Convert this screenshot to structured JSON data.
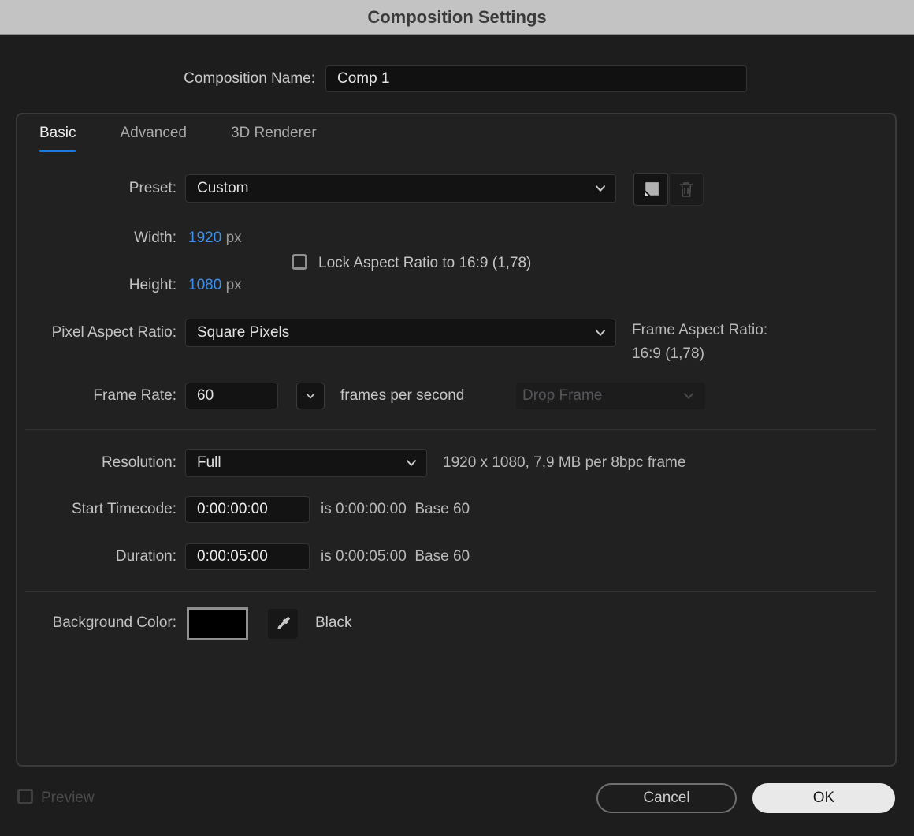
{
  "titlebar": {
    "title": "Composition Settings"
  },
  "composition_name": {
    "label": "Composition Name:",
    "value": "Comp 1"
  },
  "tabs": [
    {
      "label": "Basic",
      "active": true
    },
    {
      "label": "Advanced",
      "active": false
    },
    {
      "label": "3D Renderer",
      "active": false
    }
  ],
  "basic": {
    "preset": {
      "label": "Preset:",
      "value": "Custom"
    },
    "width": {
      "label": "Width:",
      "value": "1920",
      "unit": "px"
    },
    "height": {
      "label": "Height:",
      "value": "1080",
      "unit": "px"
    },
    "lock_aspect": {
      "label": "Lock Aspect Ratio to 16:9 (1,78)",
      "checked": false
    },
    "pixel_aspect_ratio": {
      "label": "Pixel Aspect Ratio:",
      "value": "Square Pixels"
    },
    "frame_aspect_ratio": {
      "label": "Frame Aspect Ratio:",
      "value": "16:9 (1,78)"
    },
    "frame_rate": {
      "label": "Frame Rate:",
      "value": "60",
      "suffix": "frames per second",
      "drop_frame_value": "Drop Frame",
      "drop_frame_enabled": false
    },
    "resolution": {
      "label": "Resolution:",
      "value": "Full",
      "info": "1920 x 1080, 7,9 MB per 8bpc frame"
    },
    "start_timecode": {
      "label": "Start Timecode:",
      "value": "0:00:00:00",
      "info": "is 0:00:00:00  Base 60"
    },
    "duration": {
      "label": "Duration:",
      "value": "0:00:05:00",
      "info": "is 0:00:05:00  Base 60"
    },
    "background_color": {
      "label": "Background Color:",
      "color_name": "Black",
      "swatch_hex": "#000000"
    }
  },
  "footer": {
    "preview_label": "Preview",
    "preview_checked": false,
    "cancel_label": "Cancel",
    "ok_label": "OK"
  },
  "icons": {
    "preset_save": "save-preset-icon",
    "preset_delete": "trash-icon",
    "dropdown": "chevron-down-icon",
    "background_picker": "eyedropper-icon"
  },
  "colors": {
    "accent_value_blue": "#3f8fe8",
    "active_tab_underline": "#1f78e0",
    "titlebar_gray": "#c3c3c3",
    "background_swatch": "#000000"
  }
}
